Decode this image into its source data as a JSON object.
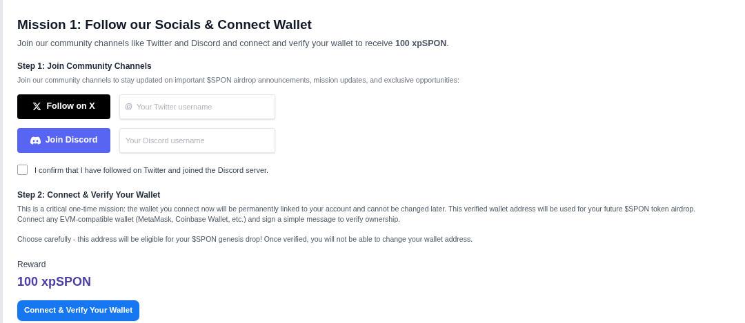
{
  "title": "Mission 1: Follow our Socials & Connect Wallet",
  "intro": "Join our community channels like Twitter and Discord and connect and verify your wallet to receive **100 xpSPON**.",
  "step1": {
    "heading": "Step 1: Join Community Channels",
    "description": "Join our community channels to stay updated on important $SPON airdrop announcements, mission updates, and exclusive opportunities:",
    "channels": [
      {
        "kind": "x",
        "button": "Follow on X",
        "prefix": "@",
        "placeholder": "Your Twitter username"
      },
      {
        "kind": "discord",
        "button": "Join Discord",
        "placeholder": "Your Discord username"
      }
    ],
    "confirm": {
      "label": "I confirm that I have followed on Twitter and joined the Discord server.",
      "checked": false
    }
  },
  "step2": {
    "heading": "Step 2: Connect & Verify Your Wallet",
    "paragraphs": [
      "This is a critical one-time mission: the wallet you connect now will be permanently linked to your account and cannot be changed later. This verified wallet address will be used for your future $SPON token airdrop. Connect any EVM-compatible wallet (MetaMask, Coinbase Wallet, etc.) and sign a simple message to verify ownership.",
      "Choose carefully - this address will be eligible for your $SPON genesis drop! Once verified, you will not be able to change your wallet address."
    ]
  },
  "reward": {
    "label": "Reward",
    "value": "100 xpSPON"
  },
  "action": "Connect & Verify Your Wallet"
}
